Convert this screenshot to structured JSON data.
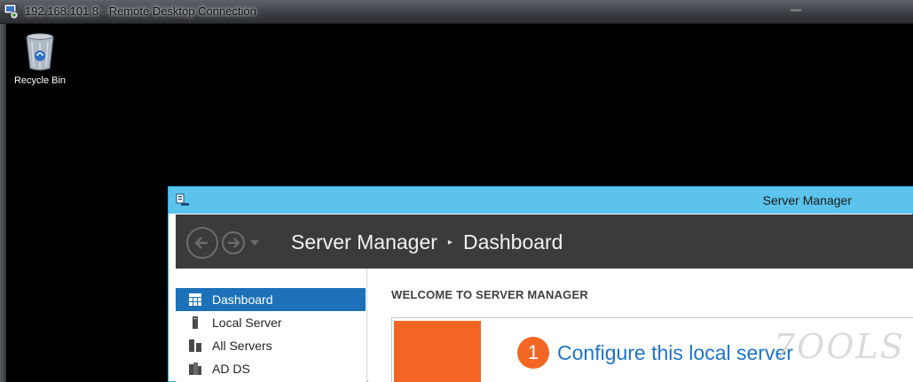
{
  "rdp": {
    "title": "192.168.101.8 - Remote Desktop Connection"
  },
  "desktop": {
    "icons": [
      {
        "label": "Recycle Bin",
        "icon": "recycle-bin-icon"
      }
    ]
  },
  "server_manager": {
    "window_title": "Server Manager",
    "breadcrumb": [
      "Server Manager",
      "Dashboard"
    ],
    "breadcrumb_separator": "▸",
    "nav": [
      {
        "label": "Dashboard",
        "icon": "dashboard-icon",
        "active": true
      },
      {
        "label": "Local Server",
        "icon": "local-server-icon",
        "active": false
      },
      {
        "label": "All Servers",
        "icon": "all-servers-icon",
        "active": false
      },
      {
        "label": "AD DS",
        "icon": "ad-ds-icon",
        "active": false
      }
    ],
    "main": {
      "welcome_heading": "WELCOME TO SERVER MANAGER",
      "step_number": "1",
      "step_link": "Configure this local server"
    },
    "watermark": "7OOLS"
  },
  "colors": {
    "titlebar": "#5bc3ec",
    "header": "#3b3b3b",
    "nav_active": "#1c71b9",
    "accent_orange": "#f26522",
    "link_blue": "#1e73c8"
  }
}
